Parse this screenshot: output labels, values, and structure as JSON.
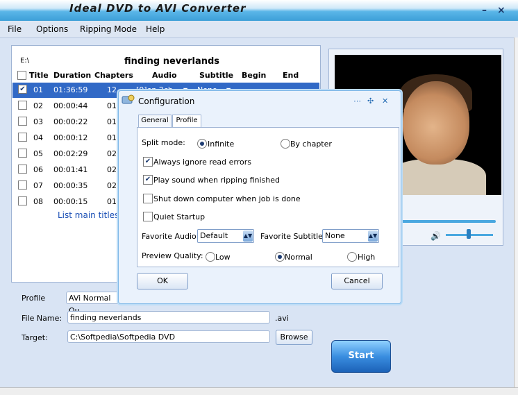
{
  "window": {
    "title": "Ideal DVD to AVI Converter",
    "minimize": "–",
    "close": "×"
  },
  "menu": [
    "File",
    "Options",
    "Ripping Mode",
    "Help"
  ],
  "titles_panel": {
    "drive": "E:\\",
    "volume_name": "finding neverlands",
    "columns": [
      "Title",
      "Duration",
      "Chapters",
      "Audio",
      "Subtitle",
      "Begin",
      "End"
    ],
    "rows": [
      {
        "title": "01",
        "duration": "01:36:59",
        "chapters": "12",
        "audio": "[0]en 2ch",
        "subtitle": "None",
        "checked": true,
        "selected": true
      },
      {
        "title": "02",
        "duration": "00:00:44",
        "chapters": "01",
        "checked": false
      },
      {
        "title": "03",
        "duration": "00:00:22",
        "chapters": "01",
        "checked": false
      },
      {
        "title": "04",
        "duration": "00:00:12",
        "chapters": "01",
        "checked": false
      },
      {
        "title": "05",
        "duration": "00:02:29",
        "chapters": "02",
        "checked": false
      },
      {
        "title": "06",
        "duration": "00:01:41",
        "chapters": "02",
        "checked": false
      },
      {
        "title": "07",
        "duration": "00:00:35",
        "chapters": "02",
        "checked": false
      },
      {
        "title": "08",
        "duration": "00:00:15",
        "chapters": "01",
        "checked": false
      }
    ],
    "list_main_titles": "List main titles..."
  },
  "output": {
    "profile_label": "Profile",
    "profile_value": "AVi Normal Qu",
    "filename_label": "File Name:",
    "filename_value": "finding neverlands",
    "filename_ext": ".avi",
    "target_label": "Target:",
    "target_value": "C:\\Softpedia\\Softpedia DVD",
    "browse_label": "Browse",
    "start_label": "Start"
  },
  "dialog": {
    "title": "Configuration",
    "tabs": [
      "General",
      "Profile"
    ],
    "split_mode_label": "Split mode:",
    "split_options": [
      "Infinite",
      "By chapter"
    ],
    "split_selected": "Infinite",
    "options": [
      {
        "label": "Always ignore read errors",
        "checked": true
      },
      {
        "label": "Play sound when ripping finished",
        "checked": true
      },
      {
        "label": "Shut down computer when job is done",
        "checked": false
      },
      {
        "label": "Quiet Startup",
        "checked": false
      }
    ],
    "favorite_audio_label": "Favorite Audio",
    "favorite_audio_value": "Default",
    "favorite_subtitle_label": "Favorite Subtitle",
    "favorite_subtitle_value": "None",
    "preview_quality_label": "Preview Quality:",
    "preview_options": [
      "Low",
      "Normal",
      "High"
    ],
    "preview_selected": "Normal",
    "ok_label": "OK",
    "cancel_label": "Cancel"
  },
  "colors": {
    "selection": "#3169c6",
    "accent": "#3a8ee0",
    "link": "#1a4fb5"
  }
}
